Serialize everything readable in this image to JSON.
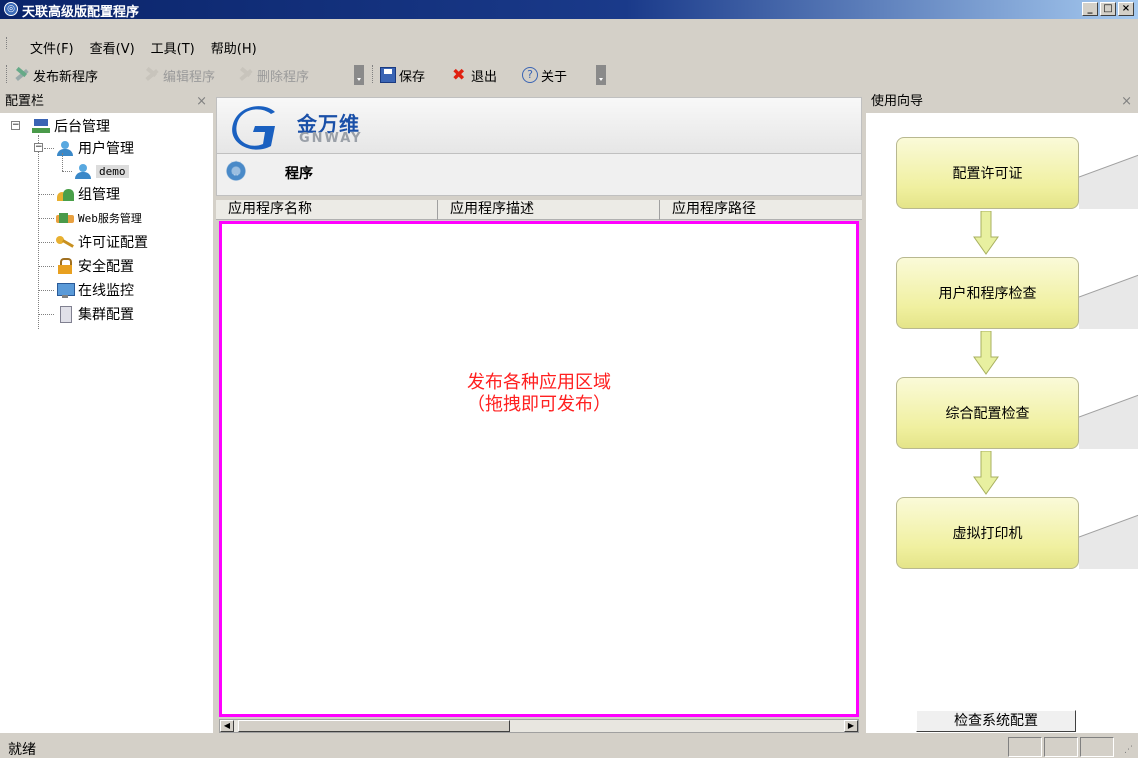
{
  "window": {
    "title": "天联高级版配置程序",
    "buttons": [
      "_",
      "□",
      "×"
    ]
  },
  "menu": {
    "items": [
      "文件(F)",
      "查看(V)",
      "工具(T)",
      "帮助(H)"
    ]
  },
  "toolbar": {
    "publish": "发布新程序",
    "edit": "编辑程序",
    "delete": "删除程序",
    "save": "保存",
    "exit": "退出",
    "about": "关于"
  },
  "left_panel": {
    "title": "配置栏",
    "close": "×",
    "tree": {
      "root": "后台管理",
      "user_mgmt": "用户管理",
      "demo": "demo",
      "group_mgmt": "组管理",
      "web_mgmt": "Web服务管理",
      "license": "许可证配置",
      "security": "安全配置",
      "monitor": "在线监控",
      "cluster": "集群配置"
    }
  },
  "center": {
    "logo_cn": "金万维",
    "logo_en": "GNWAY",
    "section_title": "程序",
    "columns": [
      "应用程序名称",
      "应用程序描述",
      "应用程序路径"
    ],
    "drop_hint_line1": "发布各种应用区域",
    "drop_hint_line2": "（拖拽即可发布）"
  },
  "right_panel": {
    "title": "使用向导",
    "close": "×",
    "steps": [
      "配置许可证",
      "用户和程序检查",
      "综合配置检查",
      "虚拟打印机"
    ],
    "check_button": "检查系统配置"
  },
  "status": {
    "text": "就绪"
  },
  "colors": {
    "titlebar": "#0a246a",
    "drop_border": "#ff00ff",
    "drop_text": "#ff2020",
    "step_fill": "#f0f0a0"
  }
}
